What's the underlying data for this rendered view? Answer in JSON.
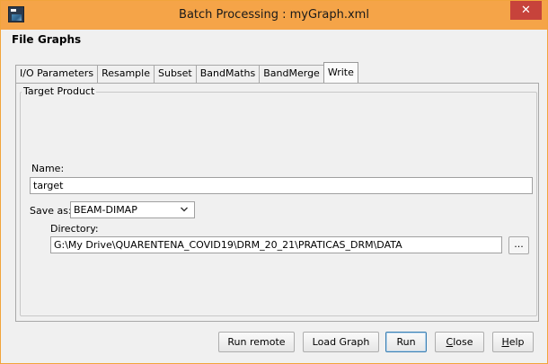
{
  "window": {
    "title": "Batch Processing : myGraph.xml",
    "close_glyph": "✕",
    "app_icon": "snap-app-icon",
    "accent_color": "#f5a448"
  },
  "menu": {
    "items": [
      {
        "label": "File"
      },
      {
        "label": "Graphs"
      }
    ]
  },
  "tabs": [
    {
      "label": "I/O Parameters"
    },
    {
      "label": "Resample"
    },
    {
      "label": "Subset"
    },
    {
      "label": "BandMaths"
    },
    {
      "label": "BandMerge"
    },
    {
      "label": "Write",
      "active": true
    }
  ],
  "target_product": {
    "legend": "Target Product",
    "name_label": "Name:",
    "name_value": "target",
    "save_as_label": "Save as:",
    "save_as_value": "BEAM-DIMAP",
    "directory_label": "Directory:",
    "directory_value": "G:\\My Drive\\QUARENTENA_COVID19\\DRM_20_21\\PRATICAS_DRM\\DATA",
    "browse_label": "..."
  },
  "buttons": {
    "run_remote": "Run remote",
    "load_graph": "Load Graph",
    "run": "Run",
    "close_first": "C",
    "close_rest": "lose",
    "help_first": "H",
    "help_rest": "elp"
  }
}
